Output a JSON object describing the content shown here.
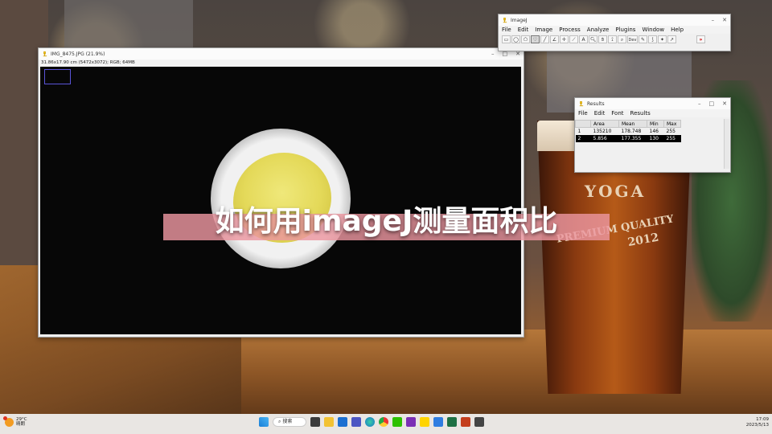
{
  "imagej": {
    "title": "ImageJ",
    "menu": [
      "File",
      "Edit",
      "Image",
      "Process",
      "Analyze",
      "Plugins",
      "Window",
      "Help"
    ],
    "tools": [
      "rect",
      "oval",
      "polygon",
      "freehand",
      "straight-line",
      "angle",
      "point",
      "wand",
      "text",
      "zoom",
      "hand",
      "color-picker",
      "magnifier",
      "Dev",
      "pencil",
      "brush",
      "flood",
      "arrow",
      "more"
    ],
    "dev_label": "Dev",
    "more_label": "»"
  },
  "image_window": {
    "title": "IMG_8475.JPG (21.9%)",
    "subtitle": "31.86x17.90 cm (5472x3072); RGB; 64MB"
  },
  "results": {
    "title": "Results",
    "menu": [
      "File",
      "Edit",
      "Font",
      "Results"
    ],
    "columns": [
      "",
      "Area",
      "Mean",
      "Min",
      "Max"
    ],
    "rows": [
      [
        "1",
        "135210",
        "178.748",
        "146",
        "255"
      ],
      [
        "2",
        "5.856",
        "177.355",
        "130",
        "255"
      ]
    ],
    "selected_row": 2
  },
  "caption": "如何用imageJ测量面积比",
  "glass": {
    "brand": "YOGA",
    "banner": "PREMIUM QUALITY",
    "year": "2012"
  },
  "taskbar": {
    "temp": "29°C",
    "weather": "晴朗",
    "search": "搜索",
    "time": "17:09",
    "date": "2023/5/13"
  },
  "colors": {
    "roi": "#5a54d8",
    "caption_band": "#eb96a0",
    "selected_row_bg": "#000000"
  }
}
